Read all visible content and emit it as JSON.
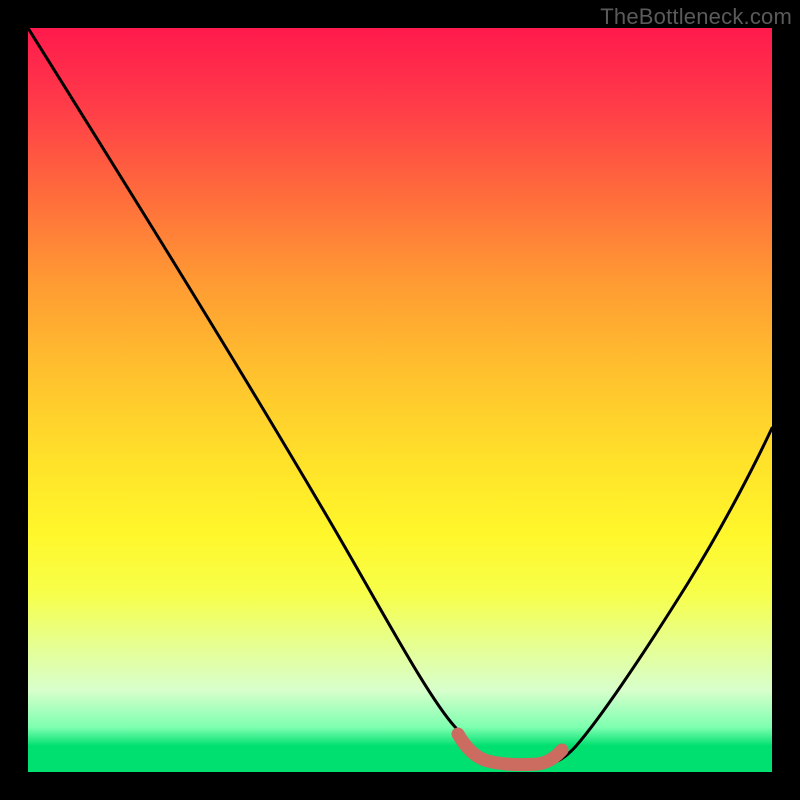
{
  "watermark": "TheBottleneck.com",
  "colors": {
    "frame": "#000000",
    "gradient_top": "#ff1a4d",
    "gradient_mid": "#ffe12a",
    "gradient_bottom": "#00e070",
    "curve_stroke": "#000000",
    "marker_stroke": "#cc6b5f"
  },
  "chart_data": {
    "type": "line",
    "title": "",
    "xlabel": "",
    "ylabel": "",
    "xlim": [
      0,
      100
    ],
    "ylim": [
      0,
      100
    ],
    "grid": false,
    "series": [
      {
        "name": "bottleneck-curve",
        "x": [
          0,
          7,
          14,
          21,
          28,
          35,
          42,
          49,
          56,
          57.5,
          60,
          65,
          70,
          72,
          74,
          78,
          84,
          90,
          96,
          100
        ],
        "y": [
          100,
          89,
          78,
          66,
          55,
          43,
          32,
          21,
          9,
          6,
          2.5,
          0.5,
          0.5,
          1.5,
          3.5,
          9,
          20,
          32,
          44,
          52
        ]
      }
    ],
    "marker": {
      "name": "optimal-range",
      "x_start": 57.5,
      "x_end": 72,
      "y": 2.5,
      "color": "#cc6b5f"
    },
    "annotations": []
  }
}
